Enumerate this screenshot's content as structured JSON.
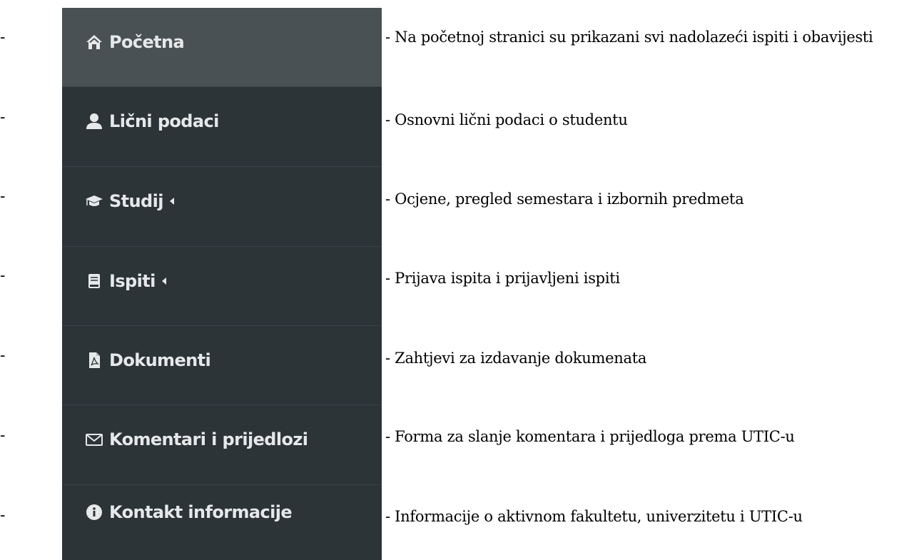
{
  "dash": "-",
  "menu": [
    {
      "label": "Početna",
      "icon": "home-icon",
      "caret": false,
      "active": true,
      "description": "- Na početnoj stranici su prikazani svi nadolazeći ispiti i obavijesti"
    },
    {
      "label": "Lični podaci",
      "icon": "user-icon",
      "caret": false,
      "active": false,
      "description": "- Osnovni lični podaci o studentu"
    },
    {
      "label": "Studij",
      "icon": "graduation-cap-icon",
      "caret": true,
      "active": false,
      "description": "- Ocjene, pregled semestara i izbornih predmeta"
    },
    {
      "label": "Ispiti",
      "icon": "book-icon",
      "caret": true,
      "active": false,
      "description": "- Prijava ispita i prijavljeni ispiti"
    },
    {
      "label": "Dokumenti",
      "icon": "pdf-file-icon",
      "caret": false,
      "active": false,
      "description": "- Zahtjevi za izdavanje dokumenata"
    },
    {
      "label": "Komentari i prijedlozi",
      "icon": "envelope-icon",
      "caret": false,
      "active": false,
      "description": "- Forma za slanje komentara i prijedloga prema UTIC-u"
    },
    {
      "label": "Kontakt informacije",
      "icon": "info-circle-icon",
      "caret": false,
      "active": false,
      "description": "- Informacije o aktivnom fakultetu, univerzitetu i UTIC-u"
    }
  ],
  "colors": {
    "sidebar_bg": "#2c3438",
    "active_bg": "#4a5154",
    "menu_text": "#e6e8e9"
  }
}
